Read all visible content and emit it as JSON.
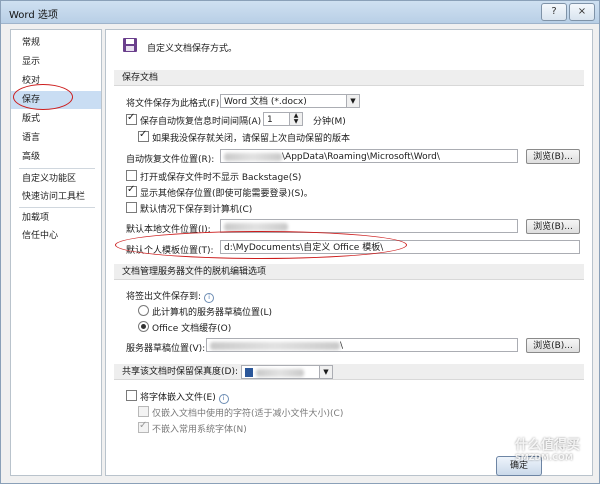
{
  "window": {
    "title": "Word 选项",
    "help_label": "?",
    "close_label": "×"
  },
  "sidebar": {
    "items": [
      {
        "label": "常规"
      },
      {
        "label": "显示"
      },
      {
        "label": "校对"
      },
      {
        "label": "保存"
      },
      {
        "label": "版式"
      },
      {
        "label": "语言"
      },
      {
        "label": "高级"
      },
      {
        "label": "自定义功能区"
      },
      {
        "label": "快速访问工具栏"
      },
      {
        "label": "加载项"
      },
      {
        "label": "信任中心"
      }
    ],
    "active_index": 3
  },
  "header": {
    "text": "自定义文档保存方式。"
  },
  "save_docs": {
    "section_title": "保存文档",
    "format_label": "将文件保存为此格式(F):",
    "format_value": "Word 文档 (*.docx)",
    "autosave_label": "保存自动恢复信息时间间隔(A)",
    "autosave_minutes": "1",
    "minutes_unit": "分钟(M)",
    "keep_last_label": "如果我没保存就关闭，请保留上次自动保留的版本",
    "autorecover_location_label": "自动恢复文件位置(R):",
    "autorecover_location_value": "\\AppData\\Roaming\\Microsoft\\Word\\",
    "browse_label": "浏览(B)...",
    "backstage_label": "打开或保存文件时不显示 Backstage(S)",
    "show_other_label": "显示其他保存位置(即使可能需要登录)(S)。",
    "default_computer_label": "默认情况下保存到计算机(C)",
    "default_local_label": "默认本地文件位置(I):",
    "default_template_label": "默认个人模板位置(T):",
    "default_template_value": "d:\\MyDocuments\\自定义 Office 模板\\"
  },
  "offline": {
    "section_title": "文档管理服务器文件的脱机编辑选项",
    "checkout_label": "将签出文件保存到:",
    "option_server_drafts": "此计算机的服务器草稿位置(L)",
    "option_office_cache": "Office 文档缓存(O)",
    "server_drafts_label": "服务器草稿位置(V):",
    "server_drafts_value": "\\",
    "browse_label": "浏览(B)..."
  },
  "fidelity": {
    "section_title": "共享该文档时保留保真度(D):",
    "embed_fonts_label": "将字体嵌入文件(E)",
    "embed_used_chars_label": "仅嵌入文档中使用的字符(适于减小文件大小)(C)",
    "no_common_fonts_label": "不嵌入常用系统字体(N)"
  },
  "footer": {
    "ok_label": "确定"
  },
  "watermark": {
    "line1": "什么值得买",
    "line2": "SMZDM.COM"
  },
  "icons": {
    "save": "floppy-disk-icon",
    "info": "info-icon",
    "document": "word-document-icon"
  },
  "colors": {
    "accent": "#c9ddf3",
    "annotation": "#cc1d1d"
  }
}
